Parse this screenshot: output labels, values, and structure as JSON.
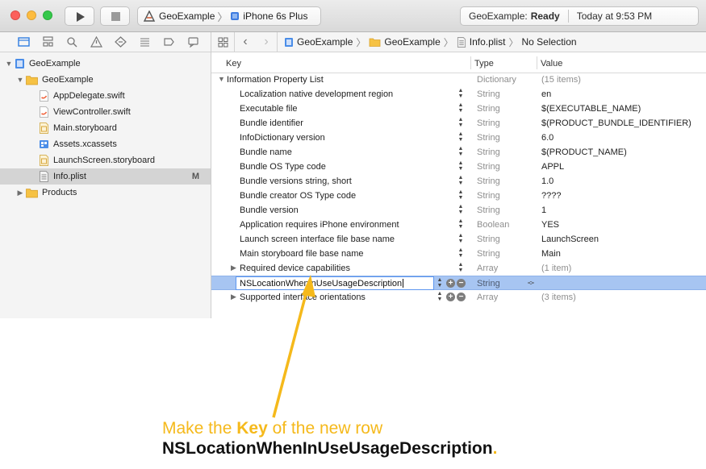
{
  "toolbar": {
    "scheme_project": "GeoExample",
    "scheme_device": "iPhone 6s Plus",
    "status_project": "GeoExample:",
    "status_state": "Ready",
    "status_time": "Today at 9:53 PM"
  },
  "navigator": {
    "items": [
      {
        "label": "GeoExample"
      },
      {
        "label": "GeoExample"
      },
      {
        "label": "AppDelegate.swift"
      },
      {
        "label": "ViewController.swift"
      },
      {
        "label": "Main.storyboard"
      },
      {
        "label": "Assets.xcassets"
      },
      {
        "label": "LaunchScreen.storyboard"
      },
      {
        "label": "Info.plist",
        "badge": "M"
      },
      {
        "label": "Products"
      }
    ]
  },
  "jumpbar": {
    "crumbs": [
      "GeoExample",
      "GeoExample",
      "Info.plist",
      "No Selection"
    ]
  },
  "plist": {
    "headers": {
      "key": "Key",
      "type": "Type",
      "value": "Value"
    },
    "root": {
      "key": "Information Property List",
      "type": "Dictionary",
      "value": "(15 items)"
    },
    "rows": [
      {
        "key": "Localization native development region",
        "type": "String",
        "value": "en"
      },
      {
        "key": "Executable file",
        "type": "String",
        "value": "$(EXECUTABLE_NAME)"
      },
      {
        "key": "Bundle identifier",
        "type": "String",
        "value": "$(PRODUCT_BUNDLE_IDENTIFIER)"
      },
      {
        "key": "InfoDictionary version",
        "type": "String",
        "value": "6.0"
      },
      {
        "key": "Bundle name",
        "type": "String",
        "value": "$(PRODUCT_NAME)"
      },
      {
        "key": "Bundle OS Type code",
        "type": "String",
        "value": "APPL"
      },
      {
        "key": "Bundle versions string, short",
        "type": "String",
        "value": "1.0"
      },
      {
        "key": "Bundle creator OS Type code",
        "type": "String",
        "value": "????"
      },
      {
        "key": "Bundle version",
        "type": "String",
        "value": "1"
      },
      {
        "key": "Application requires iPhone environment",
        "type": "Boolean",
        "value": "YES"
      },
      {
        "key": "Launch screen interface file base name",
        "type": "String",
        "value": "LaunchScreen"
      },
      {
        "key": "Main storyboard file base name",
        "type": "String",
        "value": "Main"
      },
      {
        "key": "Required device capabilities",
        "type": "Array",
        "value": "(1 item)"
      }
    ],
    "editing_row": {
      "key": "NSLocationWhenInUseUsageDescription",
      "type": "String"
    },
    "last_row": {
      "key": "Supported interface orientations",
      "type": "Array",
      "value": "(3 items)"
    }
  },
  "annotation": {
    "line1_prefix": "Make the ",
    "line1_bold": "Key",
    "line1_suffix": " of the new row",
    "line2": "NSLocationWhenInUseUsageDescription",
    "line2_dot": "."
  },
  "colors": {
    "annotation_accent": "#f5b91b",
    "selection_blue": "#a7c5f2"
  }
}
